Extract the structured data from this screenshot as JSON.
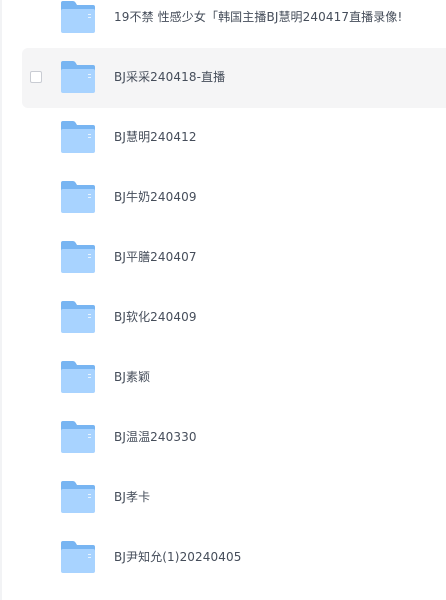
{
  "colors": {
    "folder_back": "#78b5f2",
    "folder_front": "#a8d3ff",
    "row_hover": "#f5f5f6",
    "text": "#454d5a"
  },
  "file_list": {
    "items": [
      {
        "name": "19不禁 性感少女「韩国主播BJ慧明240417直播录像!",
        "icon": "folder-icon",
        "hovered": false
      },
      {
        "name": "BJ采采240418-直播",
        "icon": "folder-icon",
        "hovered": true
      },
      {
        "name": "BJ慧明240412",
        "icon": "folder-icon",
        "hovered": false
      },
      {
        "name": "BJ牛奶240409",
        "icon": "folder-icon",
        "hovered": false
      },
      {
        "name": "BJ平膳240407",
        "icon": "folder-icon",
        "hovered": false
      },
      {
        "name": "BJ软化240409",
        "icon": "folder-icon",
        "hovered": false
      },
      {
        "name": "BJ素颖",
        "icon": "folder-icon",
        "hovered": false
      },
      {
        "name": "BJ温温240330",
        "icon": "folder-icon",
        "hovered": false
      },
      {
        "name": "BJ孝卡",
        "icon": "folder-icon",
        "hovered": false
      },
      {
        "name": "BJ尹知允(1)20240405",
        "icon": "folder-icon",
        "hovered": false
      }
    ]
  }
}
